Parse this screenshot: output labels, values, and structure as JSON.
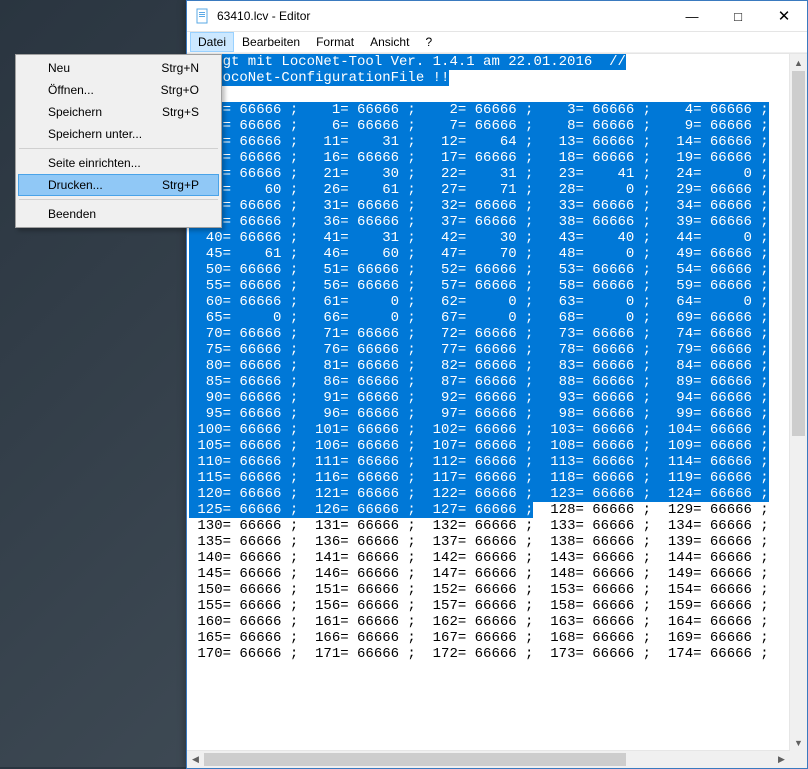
{
  "title": "63410.lcv - Editor",
  "menubar": {
    "datei": "Datei",
    "bearbeiten": "Bearbeiten",
    "format": "Format",
    "ansicht": "Ansicht",
    "help": "?"
  },
  "dropdown": {
    "neu_label": "Neu",
    "neu_sc": "Strg+N",
    "oeffnen_label": "Öffnen...",
    "oeffnen_sc": "Strg+O",
    "speichern_label": "Speichern",
    "speichern_sc": "Strg+S",
    "speichern_unter_label": "Speichern unter...",
    "seite_label": "Seite einrichten...",
    "drucken_label": "Drucken...",
    "drucken_sc": "Strg+P",
    "beenden_label": "Beenden"
  },
  "content": {
    "header1": "rzeugt mit LocoNet-Tool Ver. 1.4.1 am 22.01.2016  //",
    "header2": "!! LocoNet-ConfigurationFile !!",
    "header3": ":",
    "values": {
      "0": 66666,
      "1": 66666,
      "2": 66666,
      "3": 66666,
      "4": 66666,
      "5": 66666,
      "6": 66666,
      "7": 66666,
      "8": 66666,
      "9": 66666,
      "10": 66666,
      "11": 31,
      "12": 64,
      "13": 66666,
      "14": 66666,
      "15": 66666,
      "16": 66666,
      "17": 66666,
      "18": 66666,
      "19": 66666,
      "20": 66666,
      "21": 30,
      "22": 31,
      "23": 41,
      "24": 0,
      "25": 60,
      "26": 61,
      "27": 71,
      "28": 0,
      "29": 66666,
      "30": 66666,
      "31": 66666,
      "32": 66666,
      "33": 66666,
      "34": 66666,
      "35": 66666,
      "36": 66666,
      "37": 66666,
      "38": 66666,
      "39": 66666,
      "40": 66666,
      "41": 31,
      "42": 30,
      "43": 40,
      "44": 0,
      "45": 61,
      "46": 60,
      "47": 70,
      "48": 0,
      "49": 66666,
      "50": 66666,
      "51": 66666,
      "52": 66666,
      "53": 66666,
      "54": 66666,
      "55": 66666,
      "56": 66666,
      "57": 66666,
      "58": 66666,
      "59": 66666,
      "60": 66666,
      "61": 0,
      "62": 0,
      "63": 0,
      "64": 0,
      "65": 0,
      "66": 0,
      "67": 0,
      "68": 0,
      "69": 66666,
      "70": 66666,
      "71": 66666,
      "72": 66666,
      "73": 66666,
      "74": 66666,
      "75": 66666,
      "76": 66666,
      "77": 66666,
      "78": 66666,
      "79": 66666,
      "80": 66666,
      "81": 66666,
      "82": 66666,
      "83": 66666,
      "84": 66666,
      "85": 66666,
      "86": 66666,
      "87": 66666,
      "88": 66666,
      "89": 66666,
      "90": 66666,
      "91": 66666,
      "92": 66666,
      "93": 66666,
      "94": 66666,
      "95": 66666,
      "96": 66666,
      "97": 66666,
      "98": 66666,
      "99": 66666,
      "100": 66666,
      "101": 66666,
      "102": 66666,
      "103": 66666,
      "104": 66666,
      "105": 66666,
      "106": 66666,
      "107": 66666,
      "108": 66666,
      "109": 66666,
      "110": 66666,
      "111": 66666,
      "112": 66666,
      "113": 66666,
      "114": 66666,
      "115": 66666,
      "116": 66666,
      "117": 66666,
      "118": 66666,
      "119": 66666,
      "120": 66666,
      "121": 66666,
      "122": 66666,
      "123": 66666,
      "124": 66666,
      "125": 66666,
      "126": 66666,
      "127": 66666,
      "128": 66666,
      "129": 66666,
      "130": 66666,
      "131": 66666,
      "132": 66666,
      "133": 66666,
      "134": 66666,
      "135": 66666,
      "136": 66666,
      "137": 66666,
      "138": 66666,
      "139": 66666,
      "140": 66666,
      "141": 66666,
      "142": 66666,
      "143": 66666,
      "144": 66666,
      "145": 66666,
      "146": 66666,
      "147": 66666,
      "148": 66666,
      "149": 66666,
      "150": 66666,
      "151": 66666,
      "152": 66666,
      "153": 66666,
      "154": 66666,
      "155": 66666,
      "156": 66666,
      "157": 66666,
      "158": 66666,
      "159": 66666,
      "160": 66666,
      "161": 66666,
      "162": 66666,
      "163": 66666,
      "164": 66666,
      "165": 66666,
      "166": 66666,
      "167": 66666,
      "168": 66666,
      "169": 66666,
      "170": 66666,
      "171": 66666,
      "172": 66666,
      "173": 66666,
      "174": 66666
    },
    "selection_end_index": 127,
    "first_index": 0,
    "last_index": 174,
    "cols_per_row": 5
  }
}
